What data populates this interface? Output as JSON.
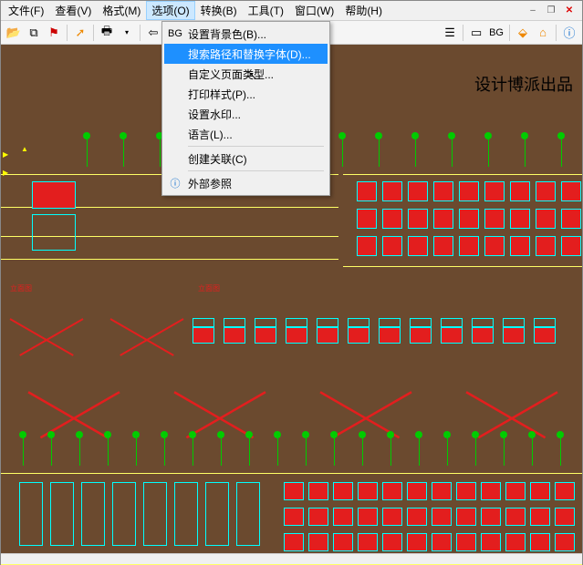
{
  "menubar": {
    "items": [
      {
        "label": "文件(F)"
      },
      {
        "label": "查看(V)"
      },
      {
        "label": "格式(M)"
      },
      {
        "label": "选项(O)"
      },
      {
        "label": "转换(B)"
      },
      {
        "label": "工具(T)"
      },
      {
        "label": "窗口(W)"
      },
      {
        "label": "帮助(H)"
      }
    ]
  },
  "toolbar": {
    "bg_label": "BG"
  },
  "dropdown": {
    "items": [
      {
        "icon": "BG",
        "label": "设置背景色(B)..."
      },
      {
        "icon": "",
        "label": "搜索路径和替换字体(D)..."
      },
      {
        "icon": "",
        "label": "自定义页面类型..."
      },
      {
        "icon": "",
        "label": "打印样式(P)..."
      },
      {
        "icon": "",
        "label": "设置水印..."
      },
      {
        "icon": "",
        "label": "语言(L)..."
      },
      {
        "icon": "",
        "label": "创建关联(C)"
      },
      {
        "icon": "ⓘ",
        "label": "外部参照"
      }
    ]
  },
  "canvas": {
    "watermark": "设计博派出品",
    "label_left": "立面图",
    "label_mid": "立面图"
  },
  "statusbar": {
    "text": ""
  }
}
